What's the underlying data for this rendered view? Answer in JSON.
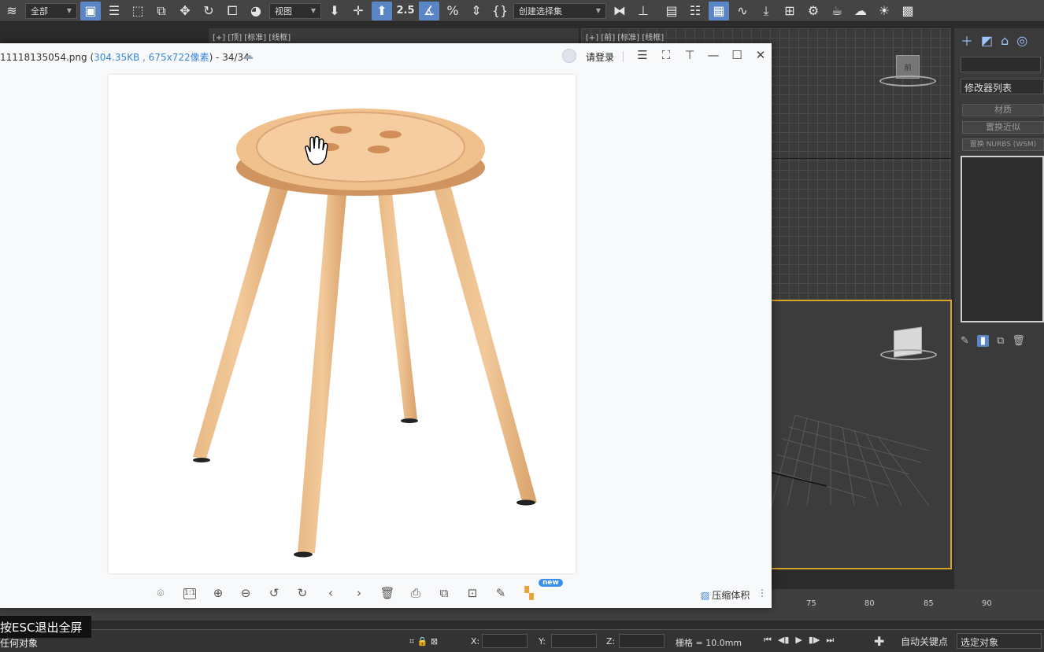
{
  "max": {
    "toolbar": {
      "filter_value": "全部",
      "refcoord_value": "视图",
      "selection_set_value": "创建选择集",
      "snap_label": "2.5"
    },
    "viewports": {
      "top_left_label": "[+] [顶] [标准] [线框]",
      "top_right_label": "[+] [前] [标准] [线框]",
      "viewcube_top_face": "前",
      "viewcube_persp_face": "前"
    },
    "command_panel": {
      "modifier_list": "修改器列表",
      "btn_material": "材质",
      "btn_replace_approx": "置换近似",
      "btn_replace_nurbs": "置换 NURBS (WSM)"
    },
    "timeline": {
      "ticks": [
        "75",
        "80",
        "85",
        "90"
      ]
    },
    "status": {
      "left_text": "任何对象",
      "x_label": "X:",
      "y_label": "Y:",
      "z_label": "Z:",
      "grid_text": "栅格 = 10.0mm",
      "autokey": "自动关键点",
      "selection_filter": "选定对象"
    }
  },
  "viewer": {
    "filename": "11118135054.png",
    "meta": "304.35KB , 675x722像素",
    "counter": "- 34/34",
    "login": "请登录",
    "tools": {
      "actual_size": "1:1",
      "new_badge": "new",
      "compress": "压缩体积"
    }
  },
  "esc_tip": "按ESC退出全屏"
}
